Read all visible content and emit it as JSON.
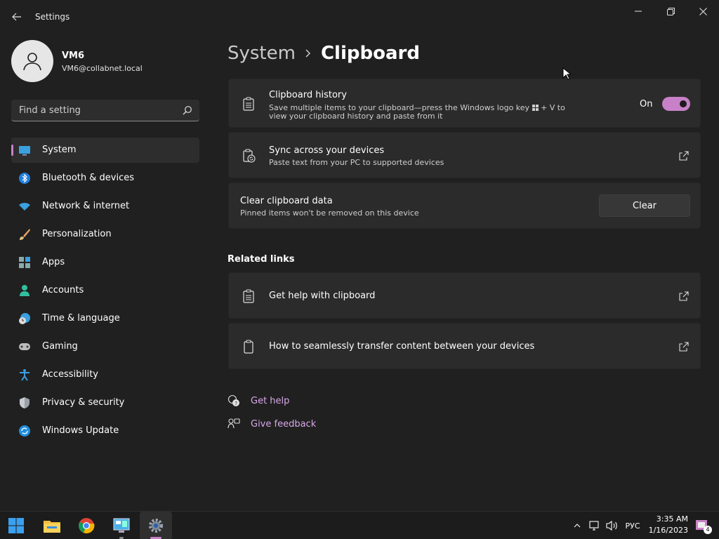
{
  "window": {
    "title": "Settings",
    "icons": {
      "back": "back-arrow-icon",
      "minimize": "minimize-icon",
      "maximize": "restore-icon",
      "close": "close-icon"
    }
  },
  "profile": {
    "name": "VM6",
    "email": "VM6@collabnet.local"
  },
  "search": {
    "placeholder": "Find a setting"
  },
  "sidebar": {
    "items": [
      {
        "label": "System",
        "icon": "monitor-icon",
        "active": true
      },
      {
        "label": "Bluetooth & devices",
        "icon": "bluetooth-icon"
      },
      {
        "label": "Network & internet",
        "icon": "wifi-icon"
      },
      {
        "label": "Personalization",
        "icon": "brush-icon"
      },
      {
        "label": "Apps",
        "icon": "apps-icon"
      },
      {
        "label": "Accounts",
        "icon": "person-icon"
      },
      {
        "label": "Time & language",
        "icon": "globe-clock-icon"
      },
      {
        "label": "Gaming",
        "icon": "gamepad-icon"
      },
      {
        "label": "Accessibility",
        "icon": "accessibility-icon"
      },
      {
        "label": "Privacy & security",
        "icon": "shield-icon"
      },
      {
        "label": "Windows Update",
        "icon": "update-icon"
      }
    ]
  },
  "breadcrumb": {
    "parent": "System",
    "current": "Clipboard"
  },
  "cards": {
    "history": {
      "title": "Clipboard history",
      "subtitle_part1": "Save multiple items to your clipboard—press the Windows logo key",
      "subtitle_part2": "+ V to view your clipboard history and paste from it",
      "toggle_label": "On",
      "toggle_on": true
    },
    "sync": {
      "title": "Sync across your devices",
      "subtitle": "Paste text from your PC to supported devices"
    },
    "clear": {
      "title": "Clear clipboard data",
      "subtitle": "Pinned items won't be removed on this device",
      "button_label": "Clear"
    }
  },
  "related": {
    "title": "Related links",
    "links": [
      {
        "label": "Get help with clipboard"
      },
      {
        "label": "How to seamlessly transfer content between your devices"
      }
    ]
  },
  "help": {
    "get_help": "Get help",
    "give_feedback": "Give feedback"
  },
  "taskbar": {
    "apps": [
      "start-icon",
      "file-explorer-icon",
      "chrome-icon",
      "control-panel-icon",
      "settings-gear-icon"
    ],
    "language": "РУС",
    "time": "3:35 AM",
    "date": "1/16/2023",
    "notification_count": "4"
  },
  "colors": {
    "accent": "#c881c8",
    "link": "#d6a8e8",
    "background": "#202020",
    "card": "#2b2b2b"
  }
}
